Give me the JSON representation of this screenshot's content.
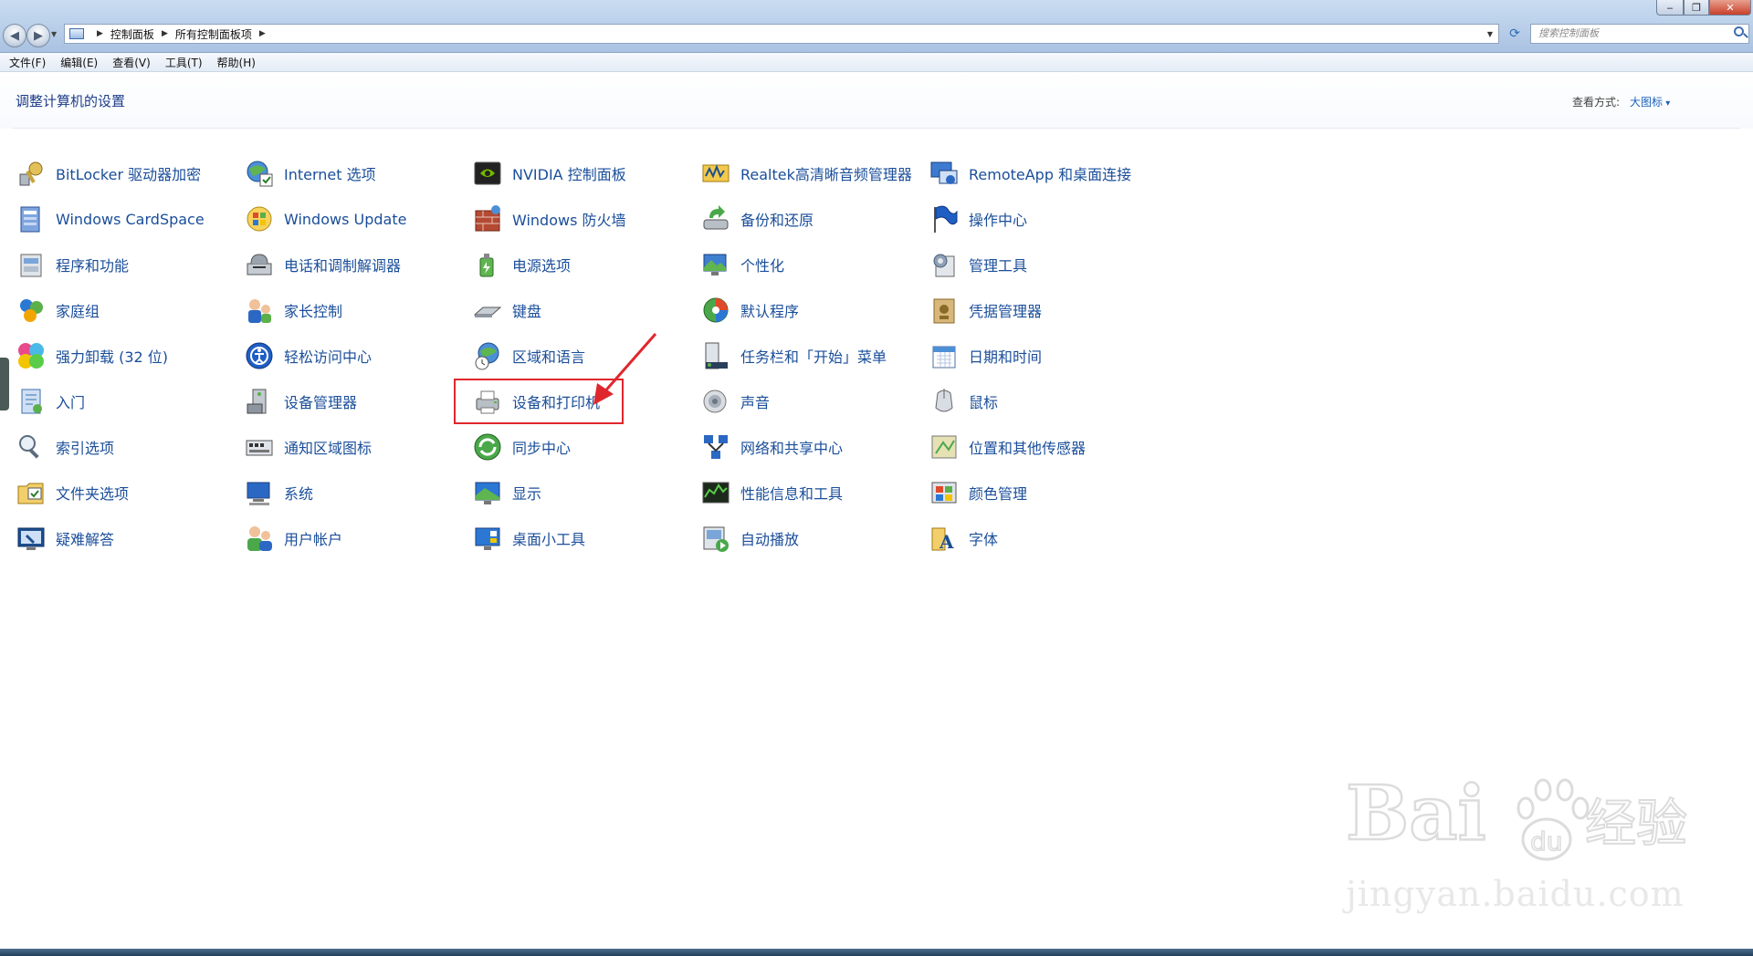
{
  "window": {
    "breadcrumb": [
      "控制面板",
      "所有控制面板项"
    ],
    "search_placeholder": "搜索控制面板"
  },
  "menu": [
    "文件(F)",
    "编辑(E)",
    "查看(V)",
    "工具(T)",
    "帮助(H)"
  ],
  "header": {
    "title": "调整计算机的设置",
    "view_label": "查看方式:",
    "view_value": "大图标"
  },
  "items": [
    {
      "label": "BitLocker 驱动器加密",
      "icon": "bitlocker-key-icon"
    },
    {
      "label": "Internet 选项",
      "icon": "internet-options-icon"
    },
    {
      "label": "NVIDIA 控制面板",
      "icon": "nvidia-icon"
    },
    {
      "label": "Realtek高清晰音频管理器",
      "icon": "realtek-audio-icon"
    },
    {
      "label": "RemoteApp 和桌面连接",
      "icon": "remoteapp-icon"
    },
    {
      "label": "Windows CardSpace",
      "icon": "cardspace-icon"
    },
    {
      "label": "Windows Update",
      "icon": "windows-update-icon"
    },
    {
      "label": "Windows 防火墙",
      "icon": "firewall-icon"
    },
    {
      "label": "备份和还原",
      "icon": "backup-icon"
    },
    {
      "label": "操作中心",
      "icon": "action-center-flag-icon"
    },
    {
      "label": "程序和功能",
      "icon": "programs-icon"
    },
    {
      "label": "电话和调制解调器",
      "icon": "phone-modem-icon"
    },
    {
      "label": "电源选项",
      "icon": "power-options-icon"
    },
    {
      "label": "个性化",
      "icon": "personalization-icon"
    },
    {
      "label": "管理工具",
      "icon": "admin-tools-icon"
    },
    {
      "label": "家庭组",
      "icon": "homegroup-icon"
    },
    {
      "label": "家长控制",
      "icon": "parental-controls-icon"
    },
    {
      "label": "键盘",
      "icon": "keyboard-icon"
    },
    {
      "label": "默认程序",
      "icon": "default-programs-icon"
    },
    {
      "label": "凭据管理器",
      "icon": "credential-manager-icon"
    },
    {
      "label": "强力卸载 (32 位)",
      "icon": "uninstaller-icon"
    },
    {
      "label": "轻松访问中心",
      "icon": "ease-of-access-icon"
    },
    {
      "label": "区域和语言",
      "icon": "region-language-icon"
    },
    {
      "label": "任务栏和「开始」菜单",
      "icon": "taskbar-start-icon"
    },
    {
      "label": "日期和时间",
      "icon": "date-time-icon"
    },
    {
      "label": "入门",
      "icon": "getting-started-icon"
    },
    {
      "label": "设备管理器",
      "icon": "device-manager-icon"
    },
    {
      "label": "设备和打印机",
      "icon": "printer-icon"
    },
    {
      "label": "声音",
      "icon": "sound-icon"
    },
    {
      "label": "鼠标",
      "icon": "mouse-icon"
    },
    {
      "label": "索引选项",
      "icon": "indexing-icon"
    },
    {
      "label": "通知区域图标",
      "icon": "notification-icons-icon"
    },
    {
      "label": "同步中心",
      "icon": "sync-center-icon"
    },
    {
      "label": "网络和共享中心",
      "icon": "network-icon"
    },
    {
      "label": "位置和其他传感器",
      "icon": "location-sensors-icon"
    },
    {
      "label": "文件夹选项",
      "icon": "folder-options-icon"
    },
    {
      "label": "系统",
      "icon": "system-icon"
    },
    {
      "label": "显示",
      "icon": "display-icon"
    },
    {
      "label": "性能信息和工具",
      "icon": "performance-icon"
    },
    {
      "label": "颜色管理",
      "icon": "color-management-icon"
    },
    {
      "label": "疑难解答",
      "icon": "troubleshooting-icon"
    },
    {
      "label": "用户帐户",
      "icon": "user-accounts-icon"
    },
    {
      "label": "桌面小工具",
      "icon": "gadgets-icon"
    },
    {
      "label": "自动播放",
      "icon": "autoplay-icon"
    },
    {
      "label": "字体",
      "icon": "fonts-icon"
    }
  ],
  "watermark": {
    "brand": "Bai",
    "brand_suffix": "经验",
    "domain": "jingyan.baidu.com"
  },
  "colors": {
    "link": "#1a4e9a",
    "title": "#1e3c8a",
    "highlight": "#e0262d"
  }
}
